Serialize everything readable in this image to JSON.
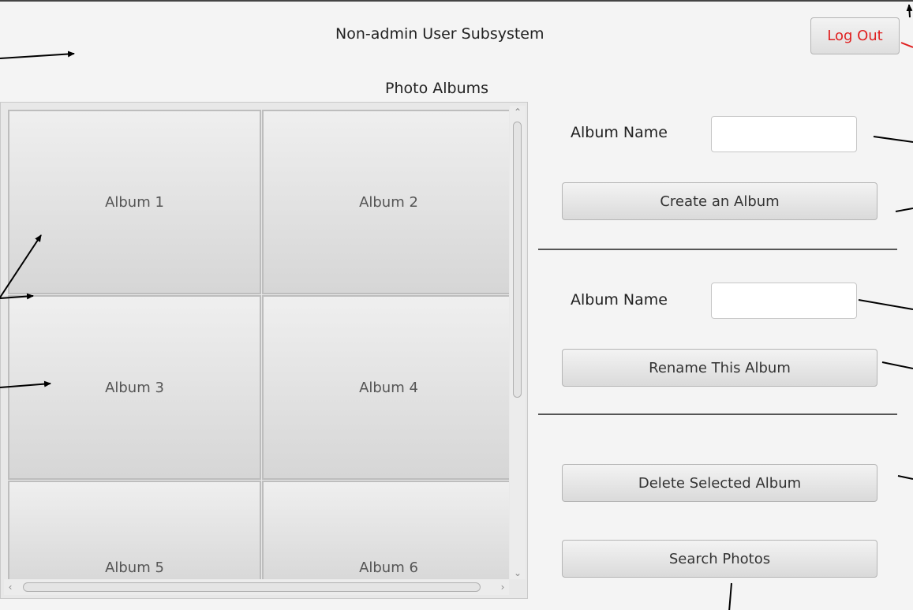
{
  "header": {
    "title": "Non-admin User Subsystem",
    "logout_label": "Log Out"
  },
  "albums_section": {
    "label": "Photo Albums",
    "albums": [
      {
        "label": "Album 1"
      },
      {
        "label": "Album 2"
      },
      {
        "label": "Album 3"
      },
      {
        "label": "Album 4"
      },
      {
        "label": "Album 5"
      },
      {
        "label": "Album 6"
      }
    ]
  },
  "create": {
    "name_label": "Album Name",
    "name_value": "",
    "button_label": "Create an Album"
  },
  "rename": {
    "name_label": "Album Name",
    "name_value": "",
    "button_label": "Rename This Album"
  },
  "delete": {
    "button_label": "Delete Selected Album"
  },
  "search": {
    "button_label": "Search Photos"
  },
  "colors": {
    "logout_text": "#e02020",
    "annotation_black": "#000000",
    "annotation_red": "#e02020"
  }
}
